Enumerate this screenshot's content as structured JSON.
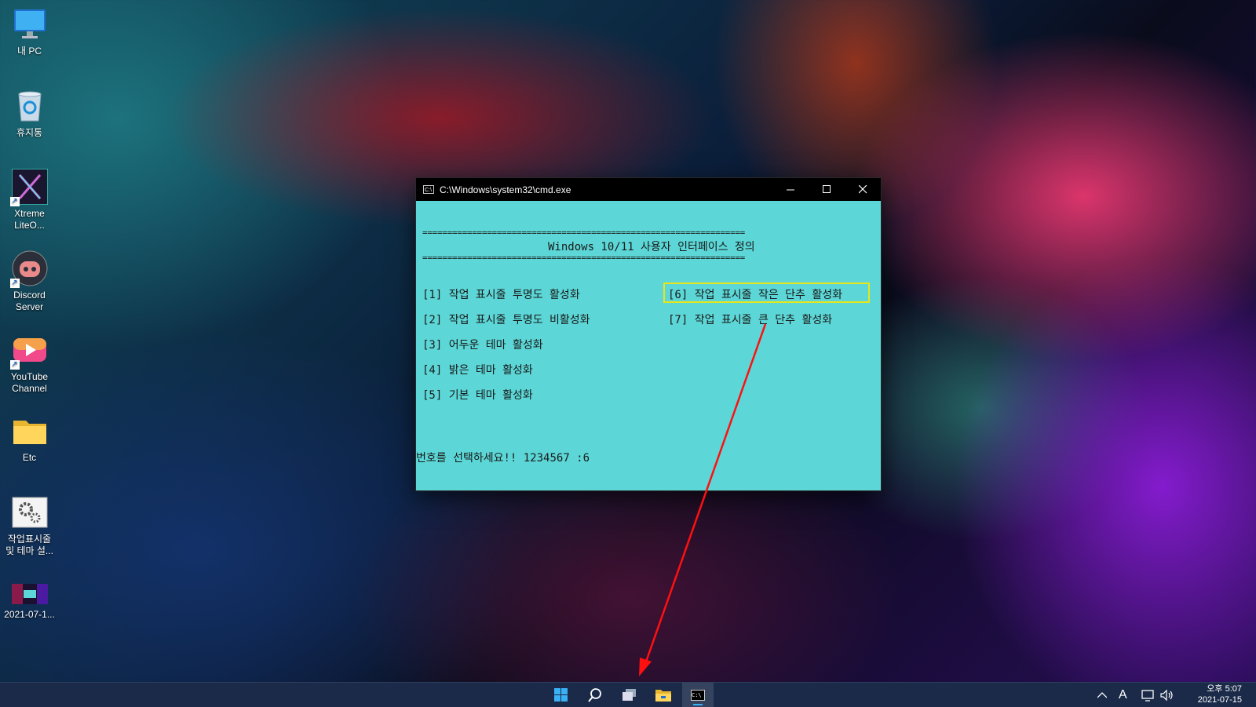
{
  "desktop": {
    "icons": [
      {
        "label": "내 PC"
      },
      {
        "label": "휴지통"
      },
      {
        "label": "Xtreme\nLiteO..."
      },
      {
        "label": "Discord\nServer"
      },
      {
        "label": "YouTube\nChannel"
      },
      {
        "label": "Etc"
      },
      {
        "label": "작업표시줄\n및 테마 설..."
      },
      {
        "label": "2021-07-1..."
      }
    ]
  },
  "cmd_window": {
    "title": "C:\\Windows\\system32\\cmd.exe",
    "icon_text": "C:\\",
    "background_color": "#5cd6d6",
    "separator": "=================================================================",
    "header": "Windows 10/11 사용자 인터페이스 정의",
    "options": [
      "[1] 작업 표시줄 투명도 활성화",
      "[2] 작업 표시줄 투명도 비활성화",
      "[3] 어두운 테마 활성화",
      "[4] 밝은 테마 활성화",
      "[5] 기본 테마 활성화",
      "[6] 작업 표시줄 작은 단추 활성화",
      "[7] 작업 표시줄 큰 단추 활성화"
    ],
    "highlighted_option": "[6] 작업 표시줄 작은 단추 활성화",
    "prompt": "번호를 선택하세요!! 1234567 :6"
  },
  "annotation": {
    "arrow_color": "#ff1010"
  },
  "taskbar": {
    "apps": [
      "start-icon",
      "search-icon",
      "task-view-icon",
      "file-explorer-icon",
      "cmd-icon"
    ],
    "cmd_icon_text": "C:\\",
    "tray": {
      "ime": "A"
    },
    "clock": {
      "time": "오후 5:07",
      "date": "2021-07-15"
    }
  }
}
